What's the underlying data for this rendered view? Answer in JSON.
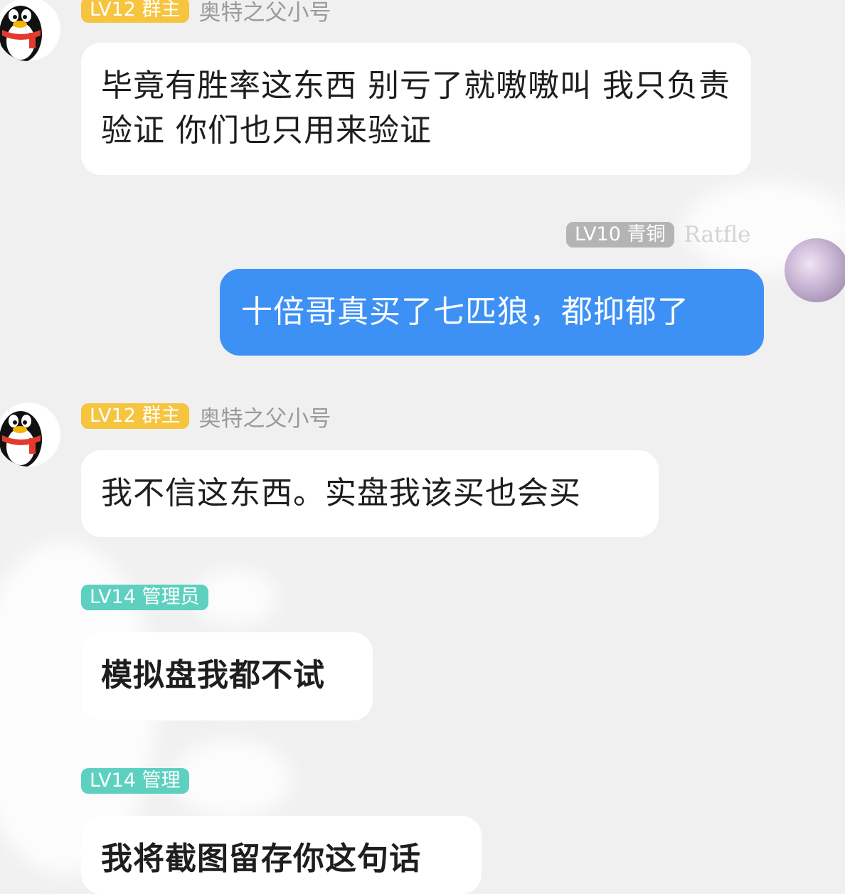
{
  "messages": [
    {
      "badge": "LV12 群主",
      "sender": "奥特之父小号",
      "text": "毕竟有胜率这东西 别亏了就嗷嗷叫 我只负责验证 你们也只用来验证"
    },
    {
      "badge": "LV10 青铜",
      "sender": "Ratfle",
      "text": "十倍哥真买了七匹狼，都抑郁了"
    },
    {
      "badge": "LV12 群主",
      "sender": "奥特之父小号",
      "text": "我不信这东西。实盘我该买也会买"
    },
    {
      "badge": "LV14 管理员",
      "sender": "",
      "text": "模拟盘我都不试"
    },
    {
      "badge": "LV14 管理",
      "sender": "",
      "text": "我将截图留存你这句话"
    }
  ],
  "avatars": {
    "left": "qq-penguin-avatar-icon",
    "right": "purple-crystal-avatar"
  },
  "colors": {
    "background": "#f0f0f0",
    "incoming_bubble": "#ffffff",
    "outgoing_bubble": "#3e91f4",
    "badge_owner": "#f6c43f",
    "badge_bronze": "#b4b4b4",
    "badge_admin": "#5ed0c0"
  }
}
